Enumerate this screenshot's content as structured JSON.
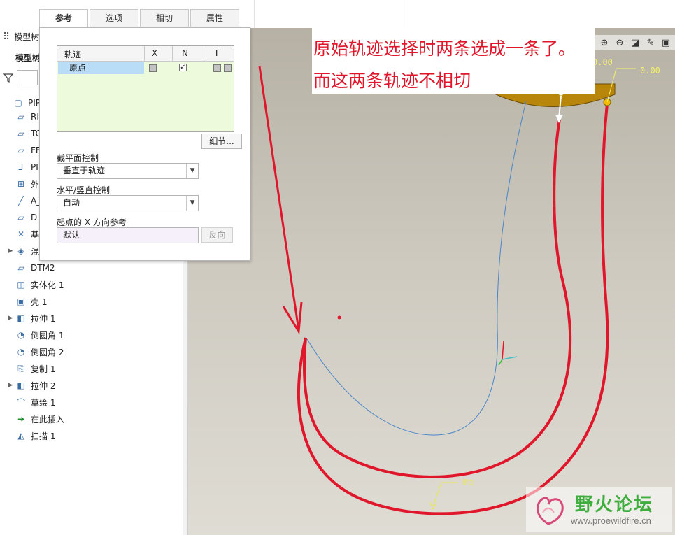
{
  "tabs": [
    {
      "label": "参考",
      "active": true
    },
    {
      "label": "选项",
      "active": false
    },
    {
      "label": "相切",
      "active": false
    },
    {
      "label": "属性",
      "active": false
    }
  ],
  "tree": {
    "header": "模型树",
    "subheader": "模型树",
    "items": [
      {
        "label": "PIPE-",
        "icon": "part-icon",
        "expand": false
      },
      {
        "label": "RI",
        "icon": "plane-icon",
        "expand": false
      },
      {
        "label": "TC",
        "icon": "plane-icon",
        "expand": false
      },
      {
        "label": "FF",
        "icon": "plane-icon",
        "expand": false
      },
      {
        "label": "PI",
        "icon": "csys-icon",
        "expand": false
      },
      {
        "label": "外",
        "icon": "external-icon",
        "expand": false
      },
      {
        "label": "A_",
        "icon": "axis-icon",
        "expand": false
      },
      {
        "label": "D",
        "icon": "plane-icon",
        "expand": false
      },
      {
        "label": "基",
        "icon": "datum-point-icon",
        "expand": false
      },
      {
        "label": "混",
        "icon": "blend-icon",
        "expand": true
      },
      {
        "label": "DTM2",
        "icon": "plane-icon",
        "expand": false
      },
      {
        "label": "实体化 1",
        "icon": "solidify-icon",
        "expand": false
      },
      {
        "label": "壳 1",
        "icon": "shell-icon",
        "expand": false
      },
      {
        "label": "拉伸 1",
        "icon": "extrude-icon",
        "expand": true
      },
      {
        "label": "倒圆角 1",
        "icon": "round-icon",
        "expand": false
      },
      {
        "label": "倒圆角 2",
        "icon": "round-icon",
        "expand": false
      },
      {
        "label": "复制 1",
        "icon": "copy-icon",
        "expand": false
      },
      {
        "label": "拉伸 2",
        "icon": "extrude-icon",
        "expand": true
      },
      {
        "label": "草绘 1",
        "icon": "sketch-icon",
        "expand": false
      },
      {
        "label": "在此插入",
        "icon": "insert-here-icon",
        "expand": false
      },
      {
        "label": "扫描 1",
        "icon": "sweep-icon",
        "expand": false
      }
    ]
  },
  "panel": {
    "grid": {
      "columns": [
        "轨迹",
        "X",
        "N",
        "T"
      ],
      "rows": [
        {
          "name": "原点",
          "x": "unchecked",
          "n": "checked",
          "t": "unchecked"
        }
      ]
    },
    "details_button": "细节...",
    "section_label": "截平面控制",
    "section_value": "垂直于轨迹",
    "hv_label": "水平/竖直控制",
    "hv_value": "自动",
    "xdir_label": "起点的 X 方向参考",
    "xdir_value": "默认",
    "flip_button": "反向"
  },
  "annotation": {
    "line1": "原始轨迹选择时两条选成一条了。",
    "line2": "而这两条轨迹不相切"
  },
  "viewport": {
    "dim_left": "0.00",
    "dim_right": "0.00",
    "origin_label": "原点",
    "trajectory_color": "#e0162b",
    "curve_color": "#4a86c8"
  },
  "watermark": {
    "name": "野火论坛",
    "url": "www.proewildfire.cn"
  }
}
